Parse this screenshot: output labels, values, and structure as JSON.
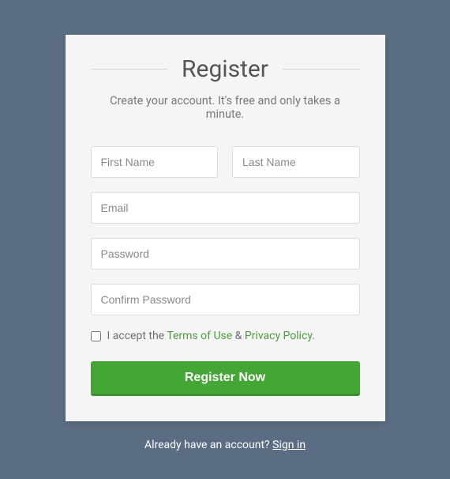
{
  "header": {
    "title": "Register",
    "subtitle": "Create your account. It's free and only takes a minute."
  },
  "form": {
    "first_name_placeholder": "First Name",
    "last_name_placeholder": "Last Name",
    "email_placeholder": "Email",
    "password_placeholder": "Password",
    "confirm_password_placeholder": "Confirm Password",
    "consent_prefix": "I accept the ",
    "terms_label": "Terms of Use",
    "consent_middle": " & ",
    "privacy_label": "Privacy Policy",
    "consent_suffix": ".",
    "submit_label": "Register Now"
  },
  "footer": {
    "prompt": "Already have an account? ",
    "signin_label": "Sign in"
  }
}
